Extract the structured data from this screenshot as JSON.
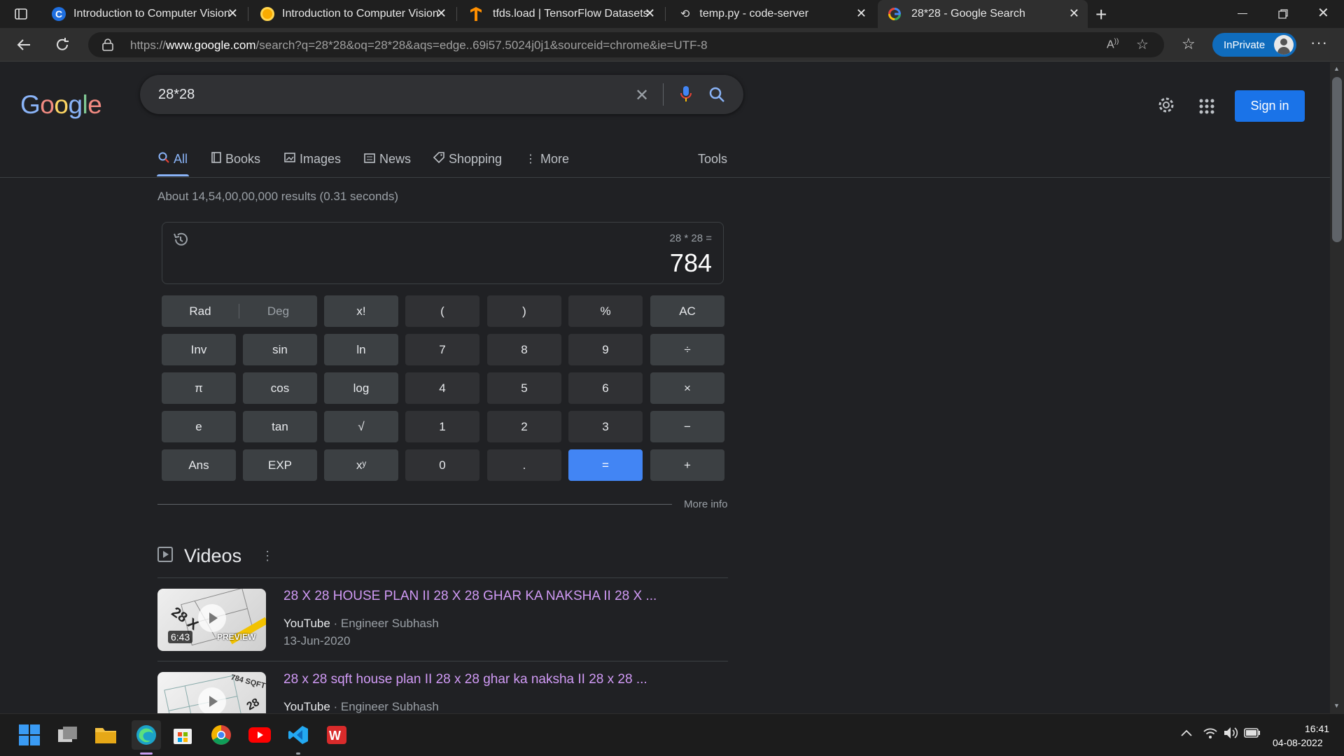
{
  "browser": {
    "tabs": [
      {
        "label": "Introduction to Computer Vision",
        "icon": "coursera-icon"
      },
      {
        "label": "Introduction to Computer Vision",
        "icon": "notebook-icon"
      },
      {
        "label": "tfds.load  |  TensorFlow Datasets",
        "icon": "tensorflow-icon"
      },
      {
        "label": "temp.py - code-server",
        "icon": "code-server-icon"
      },
      {
        "label": "28*28 - Google Search",
        "icon": "google-icon"
      }
    ],
    "url_prefix": "https://",
    "url_host": "www.google.com",
    "url_path": "/search?q=28*28&oq=28*28&aqs=edge..69i57.5024j0j1&sourceid=chrome&ie=UTF-8",
    "inprivate_label": "InPrivate"
  },
  "google": {
    "logo_letters": [
      "G",
      "o",
      "o",
      "g",
      "l",
      "e"
    ],
    "logo_colors": [
      "#8ab4f8",
      "#f28b82",
      "#fdd663",
      "#8ab4f8",
      "#81c995",
      "#f28b82"
    ],
    "query": "28*28",
    "sign_in_label": "Sign in",
    "tabs": [
      "All",
      "Books",
      "Images",
      "News",
      "Shopping",
      "More"
    ],
    "tools_label": "Tools",
    "result_stats": "About 14,54,00,00,000 results (0.31 seconds)"
  },
  "calculator": {
    "expression": "28 * 28 =",
    "result": "784",
    "keys": [
      [
        "Rad",
        "Deg",
        "x!",
        "(",
        ")",
        "%",
        "AC"
      ],
      [
        "Inv",
        "sin",
        "ln",
        "7",
        "8",
        "9",
        "÷"
      ],
      [
        "π",
        "cos",
        "log",
        "4",
        "5",
        "6",
        "×"
      ],
      [
        "e",
        "tan",
        "√",
        "1",
        "2",
        "3",
        "−"
      ],
      [
        "Ans",
        "EXP",
        "xʸ",
        "0",
        ".",
        "=",
        "+"
      ]
    ],
    "more_info": "More info"
  },
  "videos": {
    "heading": "Videos",
    "items": [
      {
        "title": "28 X 28 HOUSE PLAN II 28 X 28 GHAR KA NAKSHA II 28 X ...",
        "source": "YouTube",
        "channel": "Engineer Subhash",
        "date": "13-Jun-2020",
        "duration": "6:43",
        "thumb_text": "28 X",
        "thumb_badge": "PREVIEW"
      },
      {
        "title": "28 x 28 sqft house plan II 28 x 28 ghar ka naksha II 28 x 28 ...",
        "source": "YouTube",
        "channel": "Engineer Subhash",
        "date": "",
        "duration": "",
        "thumb_text": "784 SQFT",
        "thumb_badge": "28"
      }
    ]
  },
  "taskbar": {
    "time": "16:41",
    "date": "04-08-2022"
  }
}
